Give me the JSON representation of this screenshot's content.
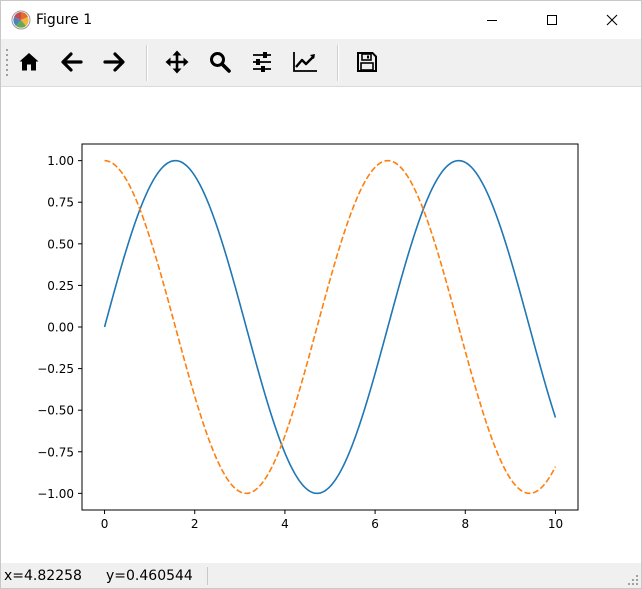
{
  "window": {
    "title": "Figure 1",
    "icons": [
      "matplotlib-logo-icon",
      "minimize-icon",
      "maximize-icon",
      "close-icon"
    ]
  },
  "toolbar": {
    "tools": [
      {
        "name": "home-icon",
        "tooltip": "Home"
      },
      {
        "name": "back-arrow-icon",
        "tooltip": "Back"
      },
      {
        "name": "forward-arrow-icon",
        "tooltip": "Forward"
      },
      {
        "name": "pan-move-icon",
        "tooltip": "Pan"
      },
      {
        "name": "zoom-magnifier-icon",
        "tooltip": "Zoom"
      },
      {
        "name": "subplots-sliders-icon",
        "tooltip": "Subplots"
      },
      {
        "name": "edit-axes-icon",
        "tooltip": "Customize"
      },
      {
        "name": "save-floppy-icon",
        "tooltip": "Save"
      }
    ]
  },
  "status": {
    "x_readout": "x=4.82258",
    "y_readout": "y=0.460544"
  },
  "chart_data": {
    "type": "line",
    "title": "",
    "xlabel": "",
    "ylabel": "",
    "xlim": [
      -0.5,
      10.5
    ],
    "ylim": [
      -1.1,
      1.1
    ],
    "xticks": [
      0,
      2,
      4,
      6,
      8,
      10
    ],
    "xtick_labels": [
      "0",
      "2",
      "4",
      "6",
      "8",
      "10"
    ],
    "yticks": [
      1.0,
      0.75,
      0.5,
      0.25,
      0.0,
      -0.25,
      -0.5,
      -0.75,
      -1.0
    ],
    "ytick_labels": [
      "1.00",
      "0.75",
      "0.50",
      "0.25",
      "0.00",
      "−0.25",
      "−0.50",
      "−0.75",
      "−1.00"
    ],
    "grid": false,
    "series": [
      {
        "function": "sin",
        "color": "#1f77b4",
        "linestyle": "solid",
        "x": [
          0,
          0.25,
          0.5,
          0.75,
          1.0,
          1.25,
          1.5,
          1.75,
          2.0,
          2.25,
          2.5,
          2.75,
          3.0,
          3.25,
          3.5,
          3.75,
          4.0,
          4.25,
          4.5,
          4.75,
          5.0,
          5.25,
          5.5,
          5.75,
          6.0,
          6.25,
          6.5,
          6.75,
          7.0,
          7.25,
          7.5,
          7.75,
          8.0,
          8.25,
          8.5,
          8.75,
          9.0,
          9.25,
          9.5,
          9.75,
          10.0
        ],
        "y": [
          0.0,
          0.247,
          0.479,
          0.682,
          0.841,
          0.949,
          0.997,
          0.984,
          0.909,
          0.778,
          0.598,
          0.382,
          0.141,
          -0.108,
          -0.351,
          -0.572,
          -0.757,
          -0.895,
          -0.978,
          -0.999,
          -0.959,
          -0.859,
          -0.706,
          -0.508,
          -0.279,
          -0.033,
          0.215,
          0.45,
          0.657,
          0.823,
          0.938,
          0.995,
          0.989,
          0.922,
          0.798,
          0.625,
          0.412,
          0.174,
          -0.075,
          -0.32,
          -0.544
        ]
      },
      {
        "function": "cos",
        "color": "#ff7f0e",
        "linestyle": "dashed",
        "x": [
          0,
          0.25,
          0.5,
          0.75,
          1.0,
          1.25,
          1.5,
          1.75,
          2.0,
          2.25,
          2.5,
          2.75,
          3.0,
          3.25,
          3.5,
          3.75,
          4.0,
          4.25,
          4.5,
          4.75,
          5.0,
          5.25,
          5.5,
          5.75,
          6.0,
          6.25,
          6.5,
          6.75,
          7.0,
          7.25,
          7.5,
          7.75,
          8.0,
          8.25,
          8.5,
          8.75,
          9.0,
          9.25,
          9.5,
          9.75,
          10.0
        ],
        "y": [
          1.0,
          0.969,
          0.878,
          0.732,
          0.54,
          0.315,
          0.071,
          -0.178,
          -0.416,
          -0.628,
          -0.801,
          -0.924,
          -0.99,
          -0.994,
          -0.936,
          -0.82,
          -0.654,
          -0.446,
          -0.211,
          0.037,
          0.284,
          0.512,
          0.709,
          0.861,
          0.96,
          0.999,
          0.977,
          0.893,
          0.754,
          0.568,
          0.347,
          0.104,
          -0.146,
          -0.388,
          -0.602,
          -0.781,
          -0.911,
          -0.985,
          -0.997,
          -0.948,
          -0.839
        ]
      }
    ]
  }
}
